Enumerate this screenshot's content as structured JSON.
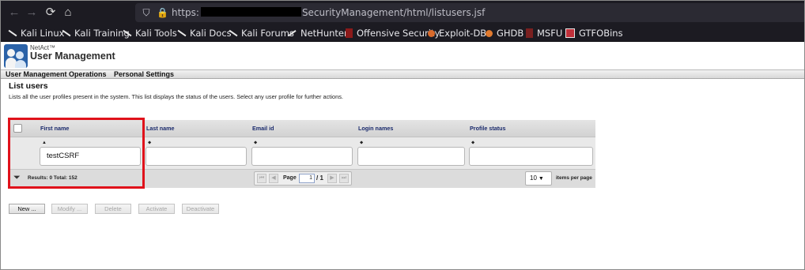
{
  "browser": {
    "url_prefix": "https:",
    "url_suffix": "SecurityManagement/html/listusers.jsf",
    "bookmarks": [
      {
        "label": "Kali Linux",
        "icon": "kali-dragon-icon"
      },
      {
        "label": "Kali Training",
        "icon": "kali-dragon-icon"
      },
      {
        "label": "Kali Tools",
        "icon": "kali-dragon-icon"
      },
      {
        "label": "Kali Docs",
        "icon": "kali-dragon-icon"
      },
      {
        "label": "Kali Forums",
        "icon": "kali-dragon-icon"
      },
      {
        "label": "NetHunter",
        "icon": "nethunter-icon"
      },
      {
        "label": "Offensive Security",
        "icon": "offsec-icon"
      },
      {
        "label": "Exploit-DB",
        "icon": "exploit-db-icon"
      },
      {
        "label": "GHDB",
        "icon": "ghdb-icon"
      },
      {
        "label": "MSFU",
        "icon": "msfu-icon"
      },
      {
        "label": "GTFOBins",
        "icon": "gtfobins-icon"
      }
    ]
  },
  "app": {
    "brand": "NetAct™",
    "title": "User Management"
  },
  "menu": {
    "items": [
      "User Management Operations",
      "Personal Settings"
    ]
  },
  "page": {
    "title": "List users",
    "description": "Lists all the user profiles present in the system. This list displays the status of the users. Select any user profile for further actions."
  },
  "table": {
    "columns": [
      "First name",
      "Last name",
      "Email id",
      "Login names",
      "Profile status"
    ],
    "sort_markers": [
      "▲",
      "⬥",
      "⬥",
      "⬥",
      "⬥"
    ],
    "filters": {
      "first_name": "testCSRF",
      "last_name": "",
      "email_id": "",
      "login_names": "",
      "profile_status": ""
    },
    "footer": {
      "results_text": "Results: 0   Total: 152",
      "page_label": "Page",
      "page_value": "1",
      "page_total": "/ 1",
      "per_page_value": "10",
      "per_page_label": "items per page"
    }
  },
  "actions": {
    "new": "New ...",
    "modify": "Modify ...",
    "delete": "Delete",
    "activate": "Activate",
    "deactivate": "Deactivate"
  },
  "colors": {
    "highlight": "#e0121b",
    "column_header_text": "#1a2a6c",
    "browser_chrome": "#1c1b22"
  }
}
